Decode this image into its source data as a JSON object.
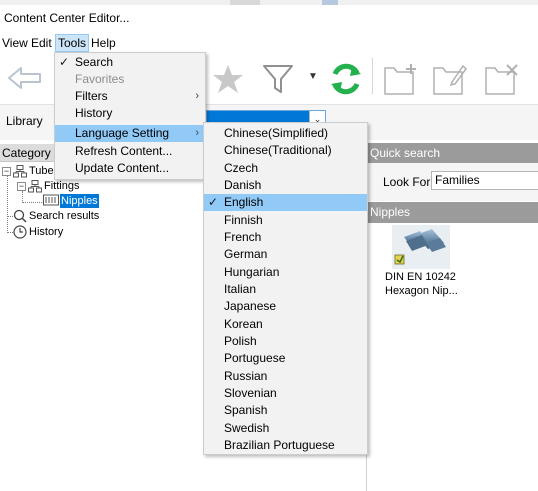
{
  "window": {
    "title": "Content Center Editor..."
  },
  "menubar": {
    "items": [
      "View",
      "Edit",
      "Tools",
      "Help"
    ]
  },
  "tools_menu": {
    "items": [
      {
        "label": "Search",
        "checked": true,
        "disabled": false,
        "submenu": false
      },
      {
        "label": "Favorites",
        "checked": false,
        "disabled": true,
        "submenu": false
      },
      {
        "label": "Filters",
        "checked": false,
        "disabled": false,
        "submenu": true
      },
      {
        "label": "History",
        "checked": false,
        "disabled": false,
        "submenu": false
      },
      {
        "label": "Language Setting",
        "checked": false,
        "disabled": false,
        "submenu": true,
        "highlighted": true
      },
      {
        "label": "Refresh Content...",
        "checked": false,
        "disabled": false,
        "submenu": false
      },
      {
        "label": "Update Content...",
        "checked": false,
        "disabled": false,
        "submenu": false
      }
    ]
  },
  "language_menu": {
    "items": [
      "Chinese(Simplified)",
      "Chinese(Traditional)",
      "Czech",
      "Danish",
      "English",
      "Finnish",
      "French",
      "German",
      "Hungarian",
      "Italian",
      "Japanese",
      "Korean",
      "Polish",
      "Portuguese",
      "Russian",
      "Slovenian",
      "Spanish",
      "Swedish",
      "Brazilian Portuguese"
    ],
    "selected": "English"
  },
  "library": {
    "label": "Library"
  },
  "category_panel": {
    "header": "Category V",
    "tree": {
      "tube": "Tube",
      "fittings": "Fittings",
      "nipples": "Nipples",
      "search_results": "Search results",
      "history": "History"
    }
  },
  "quick_search": {
    "header": "Quick search",
    "look_for_label": "Look For:",
    "look_for_value": "Families"
  },
  "results": {
    "header": "Nipples",
    "items": [
      {
        "line1": "DIN EN 10242",
        "line2": "Hexagon Nip..."
      }
    ]
  },
  "colors": {
    "accent": "#0078d7",
    "refresh_green": "#22b14c",
    "menu_highlight": "#91c9f7"
  },
  "toolbar": {
    "icons": [
      "back-arrow-icon",
      "star-icon",
      "filter-icon",
      "refresh-icon",
      "new-folder-icon",
      "edit-folder-icon",
      "delete-folder-icon"
    ]
  }
}
